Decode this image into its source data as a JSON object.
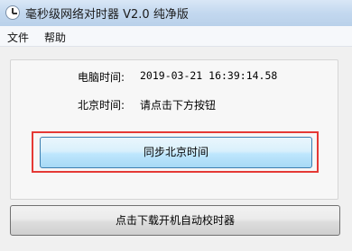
{
  "window": {
    "title": "毫秒级网络对时器 V2.0 纯净版"
  },
  "menu": {
    "items": [
      {
        "label": "文件"
      },
      {
        "label": "帮助"
      }
    ]
  },
  "main": {
    "computer_time_label": "电脑时间:",
    "computer_time_value": "2019-03-21 16:39:14.58",
    "beijing_time_label": "北京时间:",
    "beijing_time_value": "请点击下方按钮",
    "sync_button_label": "同步北京时间",
    "download_button_label": "点击下载开机自动校时器"
  },
  "colors": {
    "highlight": "#e53935",
    "sync_button": "#bee6fd"
  }
}
